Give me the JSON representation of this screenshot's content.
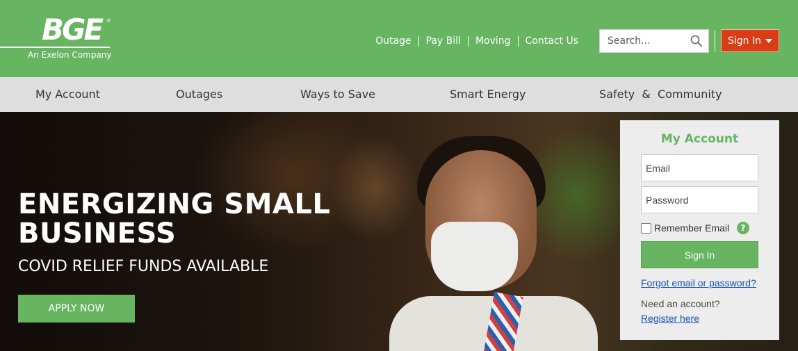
{
  "header": {
    "logo_text": "BGE",
    "logo_reg": "®",
    "logo_sub": "An Exelon Company",
    "util_links": [
      "Outage",
      "Pay Bill",
      "Moving",
      "Contact Us"
    ],
    "search_placeholder": "Search...",
    "signin_label": "Sign In"
  },
  "nav": {
    "items": [
      "My Account",
      "Outages",
      "Ways to Save",
      "Smart Energy",
      "Safety  &  Community"
    ]
  },
  "hero": {
    "title": "ENERGIZING SMALL BUSINESS",
    "subtitle": "COVID RELIEF FUNDS AVAILABLE",
    "cta": "APPLY NOW"
  },
  "login": {
    "title": "My Account",
    "email_placeholder": "Email",
    "password_placeholder": "Password",
    "remember_label": "Remember Email",
    "help": "?",
    "submit_label": "Sign In",
    "forgot_label": "Forgot email or password?",
    "need_account": "Need an account?",
    "register_label": "Register here"
  },
  "colors": {
    "brand_green": "#67b461",
    "signin_red": "#d83d16",
    "nav_gray": "#dedede",
    "link_blue": "#1a4fb5"
  },
  "icons": [
    "search-icon",
    "caret-down-icon",
    "help-icon"
  ]
}
